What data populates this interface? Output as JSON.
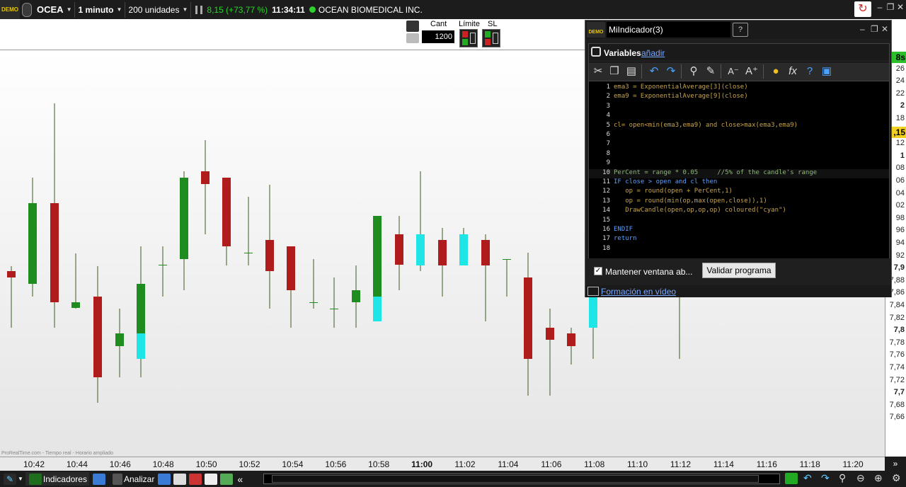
{
  "topbar": {
    "demo_label": "DEMO",
    "symbol": "OCEA",
    "timeframe": "1 minuto",
    "units": "200 unidades",
    "change": "8,15 (+73,77 %)",
    "time": "11:34:11",
    "instrument_name": "OCEAN BIOMEDICAL INC.",
    "window_controls": [
      "–",
      "❐",
      "✕"
    ]
  },
  "order_panel": {
    "cant_label": "Cant",
    "cant_value": "1200",
    "limit_label": "Límite",
    "sl_label": "SL"
  },
  "chart": {
    "watermark": "ProRealTime.com - Tiempo real - Horario ampliado",
    "time_labels": [
      "10:42",
      "10:44",
      "10:46",
      "10:48",
      "10:50",
      "10:52",
      "10:54",
      "10:56",
      "10:58",
      "11:00",
      "11:02",
      "11:04",
      "11:06",
      "11:08",
      "11:10",
      "11:12",
      "11:14",
      "11:16",
      "11:18",
      "11:20"
    ],
    "time_bold_index": 9,
    "price_labels": [
      {
        "text": "8s",
        "bold": true,
        "tag": "green"
      },
      {
        "text": "26"
      },
      {
        "text": "24"
      },
      {
        "text": "22"
      },
      {
        "text": "2",
        "bold": true
      },
      {
        "text": "18"
      },
      {
        "text": ",15",
        "bold": true,
        "tag": "yellow"
      },
      {
        "text": "12"
      },
      {
        "text": "1",
        "bold": true
      },
      {
        "text": "08"
      },
      {
        "text": "06"
      },
      {
        "text": "04"
      },
      {
        "text": "02"
      },
      {
        "text": "98"
      },
      {
        "text": "96"
      },
      {
        "text": "94"
      },
      {
        "text": "92"
      },
      {
        "text": "7,9",
        "bold": true
      },
      {
        "text": "7,88"
      },
      {
        "text": "7,86"
      },
      {
        "text": "7,84"
      },
      {
        "text": "7,82"
      },
      {
        "text": "7,8",
        "bold": true
      },
      {
        "text": "7,78"
      },
      {
        "text": "7,76"
      },
      {
        "text": "7,74"
      },
      {
        "text": "7,72"
      },
      {
        "text": "7,7",
        "bold": true
      },
      {
        "text": "7,68"
      },
      {
        "text": "7,66"
      }
    ],
    "corner_label": "»",
    "colors": {
      "up": "#1e8c1e",
      "down": "#b01c1c",
      "cyan": "#1ee6e6",
      "wick": "#3a5a1a"
    }
  },
  "editor": {
    "demo_label": "DEMO",
    "title": "MiIndicador(3)",
    "variables_label": "Variables",
    "add_label": "añadir",
    "tools": [
      "scissors-icon",
      "copy-icon",
      "paste-icon",
      "undo-icon",
      "redo-icon",
      "search-icon",
      "comment-icon",
      "font-decrease-icon",
      "font-increase-icon",
      "bulb-icon",
      "function-icon",
      "help-icon",
      "print-icon"
    ],
    "code": [
      {
        "n": "1",
        "text": "ema3 = ExponentialAverage[3](close)"
      },
      {
        "n": "2",
        "text": "ema9 = ExponentialAverage[9](close)"
      },
      {
        "n": "3",
        "text": ""
      },
      {
        "n": "4",
        "text": ""
      },
      {
        "n": "5",
        "text": "cl= open<min(ema3,ema9) and close>max(ema3,ema9)"
      },
      {
        "n": "6",
        "text": ""
      },
      {
        "n": "7",
        "text": ""
      },
      {
        "n": "8",
        "text": ""
      },
      {
        "n": "9",
        "text": ""
      },
      {
        "n": "10",
        "text": "PerCent = range * 0.05     //5% of the candle's range"
      },
      {
        "n": "11",
        "text": "IF close > open and cl then"
      },
      {
        "n": "12",
        "text": "   op = round(open + PerCent,1)"
      },
      {
        "n": "13",
        "text": "   op = round(min(op,max(open,close)),1)"
      },
      {
        "n": "14",
        "text": "   DrawCandle(open,op,op,op) coloured(\"cyan\")"
      },
      {
        "n": "15",
        "text": ""
      },
      {
        "n": "16",
        "text": "ENDIF"
      },
      {
        "n": "17",
        "text": "return"
      },
      {
        "n": "18",
        "text": ""
      }
    ],
    "keep_window_label": "Mantener ventana ab...",
    "validate_label": "Validar programa",
    "video_link": "Formación en vídeo"
  },
  "bottombar": {
    "indicators_label": "Indicadores",
    "analyze_label": "Analizar"
  }
}
